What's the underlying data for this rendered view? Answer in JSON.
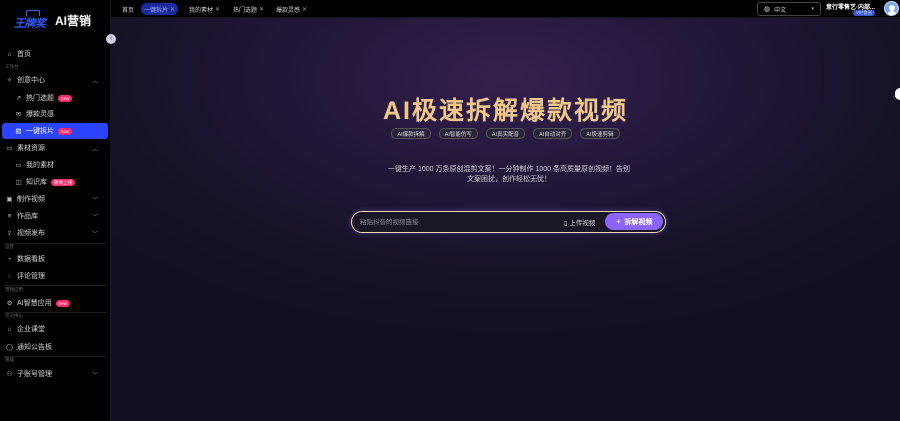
{
  "brand": {
    "logo_script": "王牌奖",
    "name": "AI营销"
  },
  "tabs": [
    {
      "label": "首页",
      "closable": false,
      "active": false
    },
    {
      "label": "一键拆片",
      "closable": true,
      "active": true
    },
    {
      "label": "我的素材",
      "closable": true,
      "active": false
    },
    {
      "label": "热门选题",
      "closable": true,
      "active": false
    },
    {
      "label": "爆款灵感",
      "closable": true,
      "active": false
    }
  ],
  "topbar": {
    "language": "中文",
    "username": "意行零售艺·内部...",
    "vip_label": "VIP会员"
  },
  "sidebar": {
    "home": "首页",
    "sections": {
      "workbench": "工作台",
      "ops": "运营",
      "marketing": "营销应用",
      "learning": "学习中心",
      "admin": "管理"
    },
    "items": {
      "creative_center": "创意中心",
      "hot_topics": "热门选题",
      "viral_ideas": "爆款灵感",
      "one_click_split": "一键拆片",
      "assets": "素材资源",
      "my_assets": "我的素材",
      "knowledge_base": "知识库",
      "make_video": "制作视频",
      "works": "作品库",
      "publish": "视频发布",
      "dashboard": "数据看板",
      "comments": "评论管理",
      "ai_apps": "AI智慧应用",
      "enterprise": "企业课堂",
      "notice": "通知公告板",
      "sub_accounts": "子账号管理"
    },
    "badges": {
      "new": "new",
      "soon": "敬请上线"
    }
  },
  "hero": {
    "title": "AI极速拆解爆款视频",
    "pills": [
      "AI爆款拆解",
      "AI智能仿写",
      "AI真实配音",
      "AI自动对齐",
      "AI极速剪辑"
    ],
    "description": "一键生产 1000 万条原创混剪文案！一分钟制作 1000 条高质量原创视频！告别文案困扰，创作轻松无忧！"
  },
  "search": {
    "placeholder": "粘贴抖音的视频链接",
    "upload_label": "上传视频",
    "submit_label": "拆解视频"
  }
}
